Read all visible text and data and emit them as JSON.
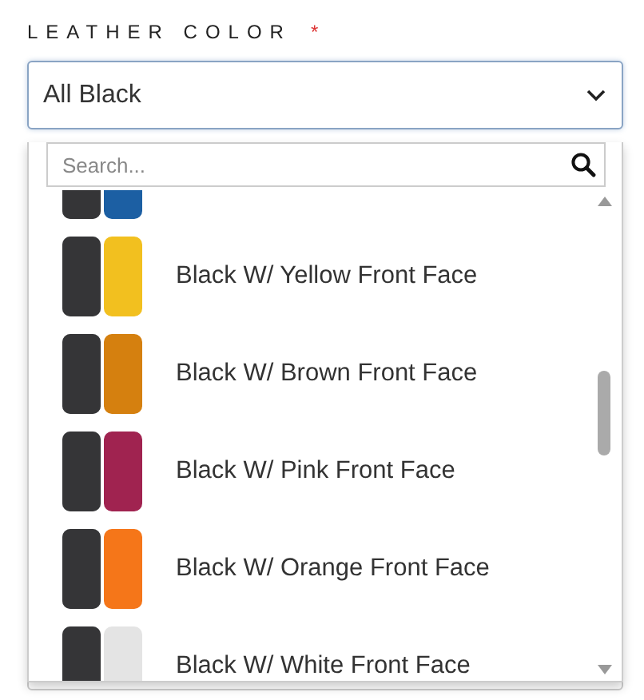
{
  "field": {
    "label": "LEATHER COLOR",
    "required_mark": "*",
    "value": "All Black",
    "expanded": true
  },
  "search": {
    "placeholder": "Search..."
  },
  "options": [
    {
      "color": "#1c5fa3"
    },
    {
      "label": "Black W/ Yellow Front Face",
      "color": "#f2c01f"
    },
    {
      "label": "Black W/ Brown Front Face",
      "color": "#d5800f"
    },
    {
      "label": "Black W/ Pink Front Face",
      "color": "#a02350"
    },
    {
      "label": "Black W/ Orange Front Face",
      "color": "#f57619"
    },
    {
      "label": "Black W/ White Front Face",
      "color": "#e4e4e4"
    }
  ]
}
